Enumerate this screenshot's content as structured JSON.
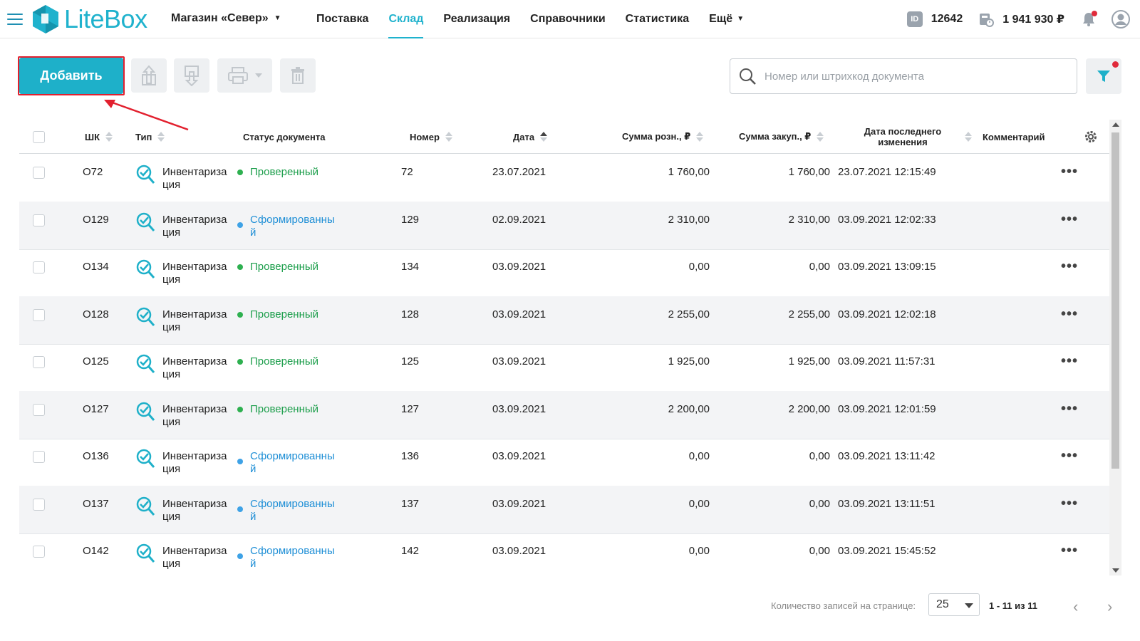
{
  "header": {
    "logo_text": "LiteBox",
    "store": "Магазин «Север»",
    "nav": [
      {
        "label": "Поставка"
      },
      {
        "label": "Склад"
      },
      {
        "label": "Реализация"
      },
      {
        "label": "Справочники"
      },
      {
        "label": "Статистика"
      },
      {
        "label": "Ещё"
      }
    ],
    "active_nav": "Склад",
    "id_badge": "ID",
    "id_value": "12642",
    "cash_value": "1 941 930 ₽"
  },
  "toolbar": {
    "add_label": "Добавить"
  },
  "search": {
    "placeholder": "Номер или штрихкод документа"
  },
  "table": {
    "columns": {
      "barcode": "ШК",
      "type": "Тип",
      "status": "Статус документа",
      "number": "Номер",
      "date": "Дата",
      "retail_sum": "Сумма розн., ₽",
      "purchase_sum": "Сумма закуп., ₽",
      "modified": "Дата последнего изменения",
      "comment": "Комментарий"
    },
    "rows": [
      {
        "barcode": "O72",
        "type": "Инвентаризация",
        "status": "Проверенный",
        "number": "72",
        "date": "23.07.2021",
        "retail": "1 760,00",
        "purchase": "1 760,00",
        "modified": "23.07.2021 12:15:49"
      },
      {
        "barcode": "O129",
        "type": "Инвентаризация",
        "status": "Сформированный",
        "number": "129",
        "date": "02.09.2021",
        "retail": "2 310,00",
        "purchase": "2 310,00",
        "modified": "03.09.2021 12:02:33"
      },
      {
        "barcode": "O134",
        "type": "Инвентаризация",
        "status": "Проверенный",
        "number": "134",
        "date": "03.09.2021",
        "retail": "0,00",
        "purchase": "0,00",
        "modified": "03.09.2021 13:09:15"
      },
      {
        "barcode": "O128",
        "type": "Инвентаризация",
        "status": "Проверенный",
        "number": "128",
        "date": "03.09.2021",
        "retail": "2 255,00",
        "purchase": "2 255,00",
        "modified": "03.09.2021 12:02:18"
      },
      {
        "barcode": "O125",
        "type": "Инвентаризация",
        "status": "Проверенный",
        "number": "125",
        "date": "03.09.2021",
        "retail": "1 925,00",
        "purchase": "1 925,00",
        "modified": "03.09.2021 11:57:31"
      },
      {
        "barcode": "O127",
        "type": "Инвентаризация",
        "status": "Проверенный",
        "number": "127",
        "date": "03.09.2021",
        "retail": "2 200,00",
        "purchase": "2 200,00",
        "modified": "03.09.2021 12:01:59"
      },
      {
        "barcode": "O136",
        "type": "Инвентаризация",
        "status": "Сформированный",
        "number": "136",
        "date": "03.09.2021",
        "retail": "0,00",
        "purchase": "0,00",
        "modified": "03.09.2021 13:11:42"
      },
      {
        "barcode": "O137",
        "type": "Инвентаризация",
        "status": "Сформированный",
        "number": "137",
        "date": "03.09.2021",
        "retail": "0,00",
        "purchase": "0,00",
        "modified": "03.09.2021 13:11:51"
      },
      {
        "barcode": "O142",
        "type": "Инвентаризация",
        "status": "Сформированный",
        "number": "142",
        "date": "03.09.2021",
        "retail": "0,00",
        "purchase": "0,00",
        "modified": "03.09.2021 15:45:52"
      }
    ]
  },
  "footer": {
    "per_page_label": "Количество записей на странице:",
    "per_page_value": "25",
    "range": "1 - 11 из 11"
  },
  "colors": {
    "accent": "#1eb0c9",
    "checked_status": "#1c9e4b",
    "formed_status": "#1f8fd6",
    "highlight": "#e2202e"
  }
}
